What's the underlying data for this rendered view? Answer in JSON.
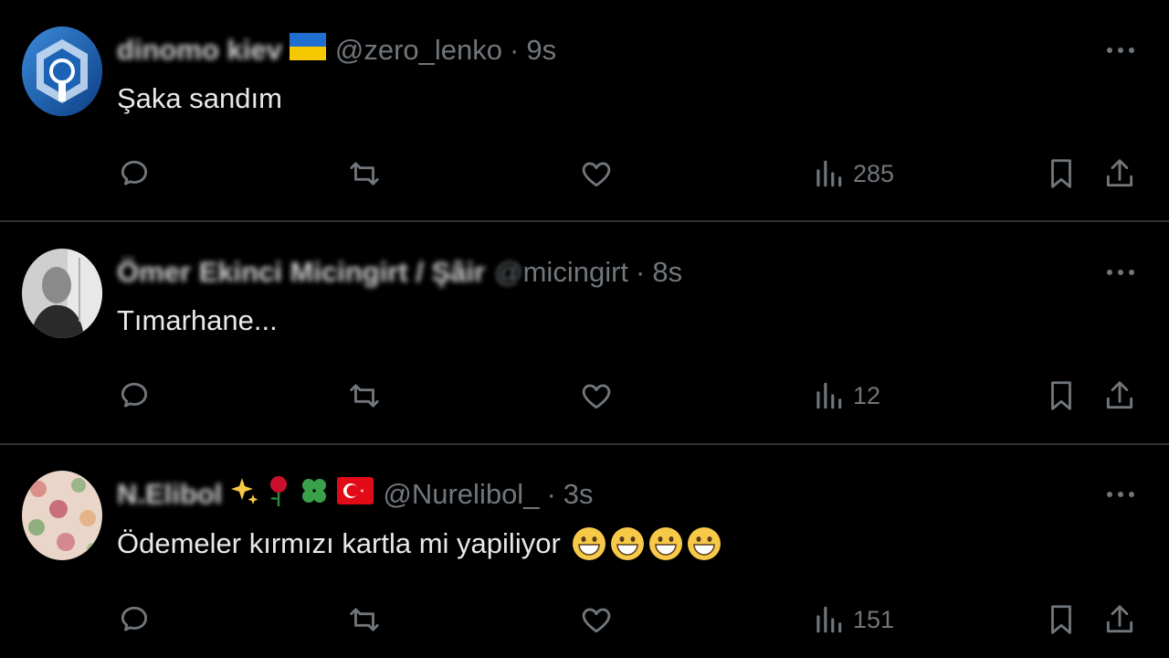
{
  "tweets": [
    {
      "display_name": "dinomo kiev",
      "flag": "ukraine-flag-icon",
      "handle": "@zero_lenko",
      "dot": "·",
      "time": "9s",
      "text": "Şaka sandım",
      "views": "285",
      "avatar": "dynamo-kyiv-logo"
    },
    {
      "display_name": "Ömer Ekinci Micingirt / Şâir",
      "handle_blurred": "@",
      "handle": "micingirt",
      "dot": "·",
      "time": "8s",
      "text": "Tımarhane...",
      "views": "12",
      "avatar": "grayscale-portrait"
    },
    {
      "display_name": "N.Elibol",
      "decorations": [
        "sparkles-emoji",
        "rose-emoji",
        "four-leaf-clover-emoji",
        "turkey-flag-icon"
      ],
      "handle": "@Nurelibol_",
      "dot": "·",
      "time": "3s",
      "text": "Ödemeler kırmızı kartla mi yapiliyor",
      "text_emojis": [
        "grinning-face-emoji",
        "grinning-face-emoji",
        "grinning-face-emoji",
        "grinning-face-emoji"
      ],
      "views": "151",
      "avatar": "floral-pattern"
    }
  ],
  "colors": {
    "background": "#000000",
    "text_primary": "#e7e9ea",
    "text_secondary": "#71767b",
    "divider": "#2f3336"
  }
}
